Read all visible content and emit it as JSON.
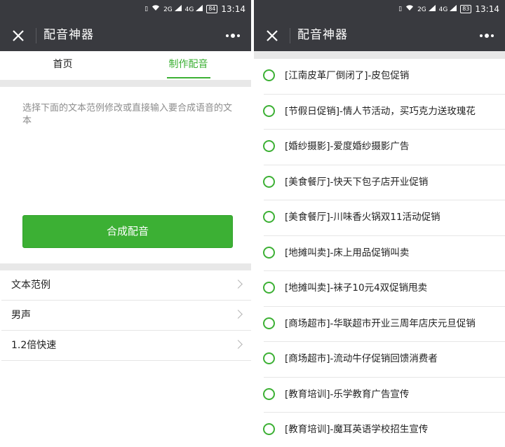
{
  "status_left": {
    "time": "13:14",
    "battery": "84",
    "net1": "2G",
    "net2": "4G"
  },
  "status_right": {
    "time": "13:14",
    "battery": "83",
    "net1": "2G",
    "net2": "4G"
  },
  "app": {
    "title": "配音神器"
  },
  "tabs": [
    {
      "label": "首页",
      "active": false
    },
    {
      "label": "制作配音",
      "active": true
    }
  ],
  "editor": {
    "placeholder": "选择下面的文本范例修改或直接输入要合成语音的文本"
  },
  "synth_button": "合成配音",
  "settings": [
    {
      "label": "文本范例"
    },
    {
      "label": "男声"
    },
    {
      "label": "1.2倍快速"
    }
  ],
  "samples": [
    {
      "label": "[江南皮革厂倒闭了]-皮包促销"
    },
    {
      "label": "[节假日促销]-情人节活动，买巧克力送玫瑰花"
    },
    {
      "label": "[婚纱摄影]-爱度婚纱摄影广告"
    },
    {
      "label": "[美食餐厅]-快天下包子店开业促销"
    },
    {
      "label": "[美食餐厅]-川味香火锅双11活动促销"
    },
    {
      "label": "[地摊叫卖]-床上用品促销叫卖"
    },
    {
      "label": "[地摊叫卖]-袜子10元4双促销甩卖"
    },
    {
      "label": "[商场超市]-华联超市开业三周年店庆元旦促销"
    },
    {
      "label": "[商场超市]-流动牛仔促销回馈消费者"
    },
    {
      "label": "[教育培训]-乐学教育广告宣传"
    },
    {
      "label": "[教育培训]-魔耳英语学校招生宣传"
    }
  ],
  "colors": {
    "accent": "#3cb034",
    "bar": "#393a3f",
    "band": "#e8e8e8"
  },
  "icons": [
    "close-icon",
    "more-icon",
    "chevron-right-icon",
    "radio-icon",
    "wifi-icon",
    "signal-icon",
    "battery-icon"
  ]
}
